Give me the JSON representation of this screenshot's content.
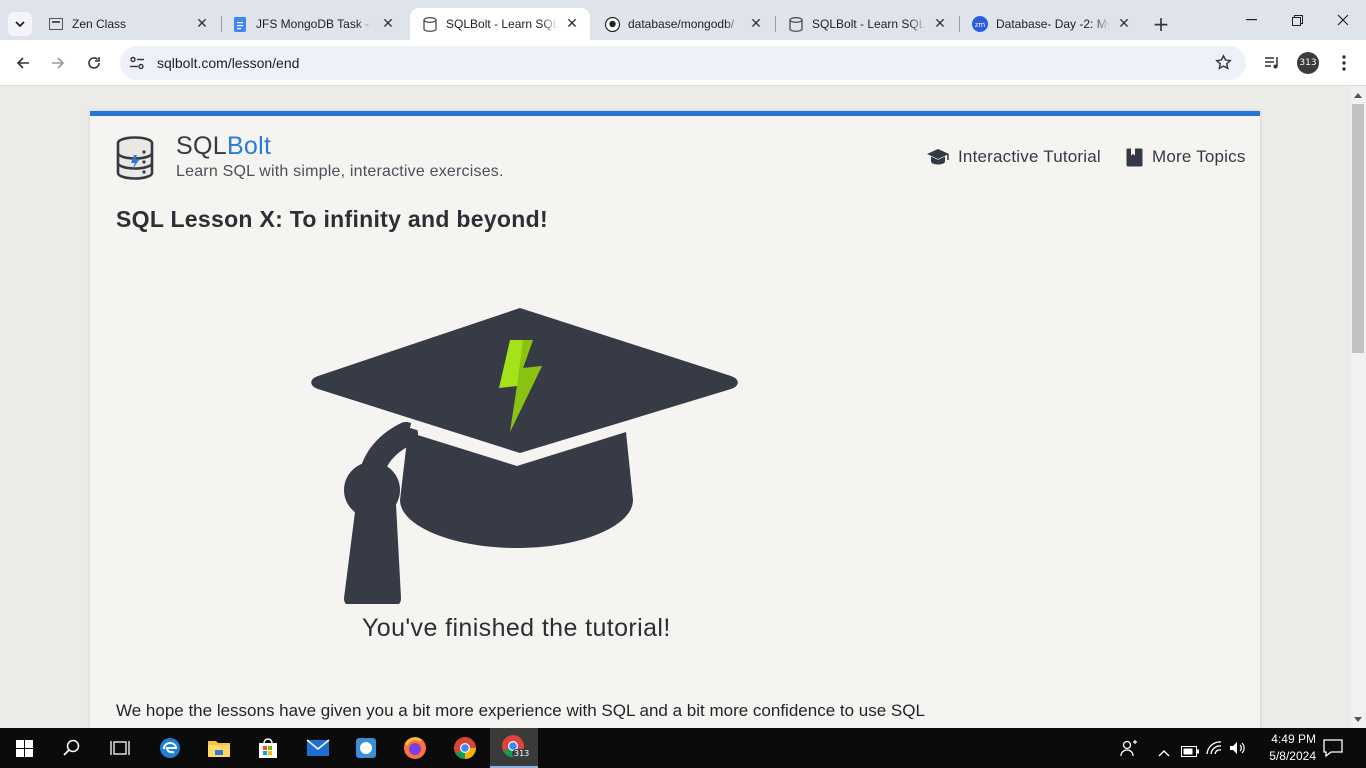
{
  "tabs": [
    {
      "title": "Zen Class"
    },
    {
      "title": "JFS MongoDB Task - G"
    },
    {
      "title": "SQLBolt - Learn SQL - "
    },
    {
      "title": "database/mongodb/"
    },
    {
      "title": "SQLBolt - Learn SQL - "
    },
    {
      "title": "Database- Day -2: My"
    }
  ],
  "address": {
    "url": "sqlbolt.com/lesson/end"
  },
  "profile_badge": "313",
  "site": {
    "brand_plain": "SQL",
    "brand_accent": "Bolt",
    "tagline": "Learn SQL with simple, interactive exercises.",
    "nav": [
      {
        "label": "Interactive Tutorial",
        "icon": "graduation-cap-icon"
      },
      {
        "label": "More Topics",
        "icon": "book-icon"
      }
    ],
    "accent_color": "#2477d6"
  },
  "content": {
    "lesson_title": "SQL Lesson X: To infinity and beyond!",
    "finished_text": "You've finished the tutorial!",
    "paragraph": "We hope the lessons have given you a bit more experience with SQL and a bit more confidence to use SQL"
  },
  "taskbar": {
    "time": "4:49 PM",
    "date": "5/8/2024",
    "chrome_badge": "313"
  }
}
